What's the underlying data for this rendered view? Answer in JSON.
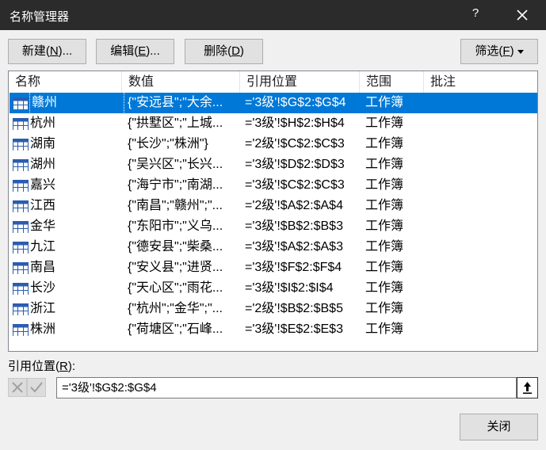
{
  "window": {
    "title": "名称管理器",
    "help_label": "?"
  },
  "toolbar": {
    "new_text": "新建(",
    "new_key": "N",
    "new_suffix": ")...",
    "edit_text": "编辑(",
    "edit_key": "E",
    "edit_suffix": ")...",
    "delete_text": "删除(",
    "delete_key": "D",
    "delete_suffix": ")",
    "filter_text": "筛选(",
    "filter_key": "F",
    "filter_suffix": ")"
  },
  "list": {
    "columns": [
      "名称",
      "数值",
      "引用位置",
      "范围",
      "批注"
    ],
    "rows": [
      {
        "name": "赣州",
        "value": "{\"安远县\";\"大余...",
        "ref": "='3级'!$G$2:$G$4",
        "scope": "工作簿",
        "note": ""
      },
      {
        "name": "杭州",
        "value": "{\"拱墅区\";\"上城...",
        "ref": "='3级'!$H$2:$H$4",
        "scope": "工作簿",
        "note": ""
      },
      {
        "name": "湖南",
        "value": "{\"长沙\";\"株洲\"}",
        "ref": "='2级'!$C$2:$C$3",
        "scope": "工作簿",
        "note": ""
      },
      {
        "name": "湖州",
        "value": "{\"吴兴区\";\"长兴...",
        "ref": "='3级'!$D$2:$D$3",
        "scope": "工作簿",
        "note": ""
      },
      {
        "name": "嘉兴",
        "value": "{\"海宁市\";\"南湖...",
        "ref": "='3级'!$C$2:$C$3",
        "scope": "工作簿",
        "note": ""
      },
      {
        "name": "江西",
        "value": "{\"南昌\";\"赣州\";\"...",
        "ref": "='2级'!$A$2:$A$4",
        "scope": "工作簿",
        "note": ""
      },
      {
        "name": "金华",
        "value": "{\"东阳市\";\"义乌...",
        "ref": "='3级'!$B$2:$B$3",
        "scope": "工作簿",
        "note": ""
      },
      {
        "name": "九江",
        "value": "{\"德安县\";\"柴桑...",
        "ref": "='3级'!$A$2:$A$3",
        "scope": "工作簿",
        "note": ""
      },
      {
        "name": "南昌",
        "value": "{\"安义县\";\"进贤...",
        "ref": "='3级'!$F$2:$F$4",
        "scope": "工作簿",
        "note": ""
      },
      {
        "name": "长沙",
        "value": "{\"天心区\";\"雨花...",
        "ref": "='3级'!$I$2:$I$4",
        "scope": "工作簿",
        "note": ""
      },
      {
        "name": "浙江",
        "value": "{\"杭州\";\"金华\";\"...",
        "ref": "='2级'!$B$2:$B$5",
        "scope": "工作簿",
        "note": ""
      },
      {
        "name": "株洲",
        "value": "{\"荷塘区\";\"石峰...",
        "ref": "='3级'!$E$2:$E$3",
        "scope": "工作簿",
        "note": ""
      }
    ],
    "selected_index": 0
  },
  "refers_to": {
    "label_text": "引用位置(",
    "label_key": "R",
    "label_suffix": "):",
    "value": "='3级'!$G$2:$G$4"
  },
  "footer": {
    "close_label": "关闭"
  },
  "colors": {
    "titlebar": "#2b2b2b",
    "selection": "#0078d7",
    "button_face": "#e1e1e1",
    "dialog_bg": "#f0f0f0"
  }
}
